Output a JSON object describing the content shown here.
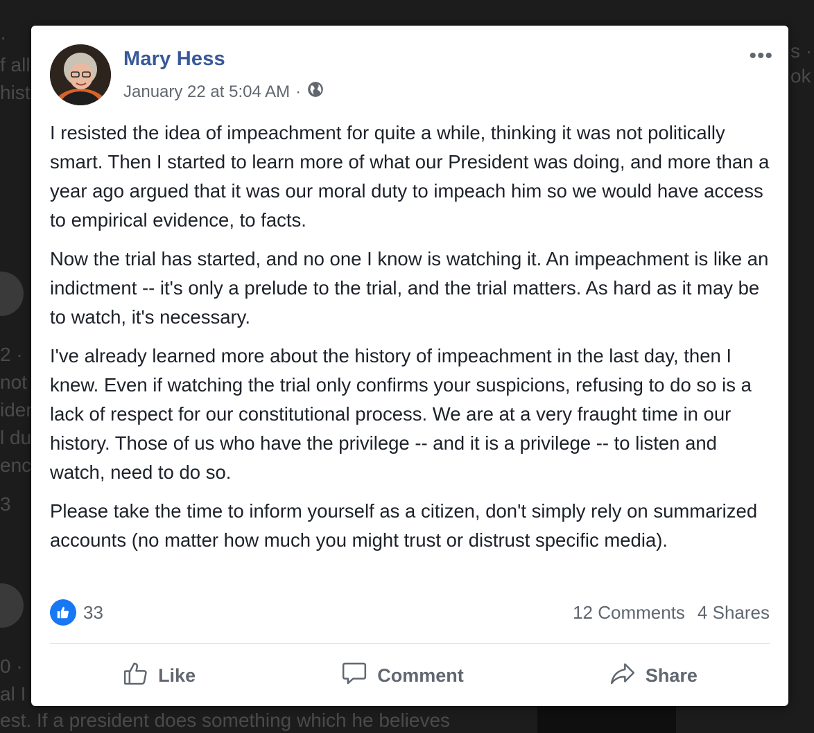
{
  "background_feed": {
    "fragments": [
      "·",
      "f all",
      "histi",
      "2 ·",
      "not",
      "iden",
      "l du",
      "ence",
      "3",
      "0 ·",
      "al I",
      "est. If a president does something which he believes",
      "s ·",
      "ok"
    ]
  },
  "post": {
    "author": "Mary Hess",
    "timestamp": "January 22 at 5:04 AM",
    "separator": "·",
    "privacy_icon": "globe-icon",
    "more_label": "•••",
    "paragraphs": [
      "I resisted the idea of impeachment for quite a while, thinking it was not politically smart. Then I started to learn more of what our President was doing, and more than a year ago argued that it was our moral duty to impeach him so we would have access to empirical evidence, to facts.",
      "Now the trial has started, and no one I know is watching it. An impeachment is like an indictment -- it's only a prelude to the trial, and the trial matters. As hard as it may be to watch, it's necessary.",
      "I've already learned more about the history of impeachment in the last day, then I knew. Even if watching the trial only confirms your suspicions, refusing to do so is a lack of respect for our constitutional process. We are at a very fraught time in our history. Those of us who have the privilege -- and it is a privilege -- to listen and watch, need to do so.",
      "Please take the time to inform yourself as a citizen, don't simply rely on summarized accounts (no matter how much you might trust or distrust specific media)."
    ],
    "reactions": {
      "count": "33"
    },
    "comments": "12 Comments",
    "shares": "4 Shares",
    "actions": {
      "like": "Like",
      "comment": "Comment",
      "share": "Share"
    },
    "colors": {
      "author": "#385898",
      "like_badge": "#1877f2"
    }
  }
}
